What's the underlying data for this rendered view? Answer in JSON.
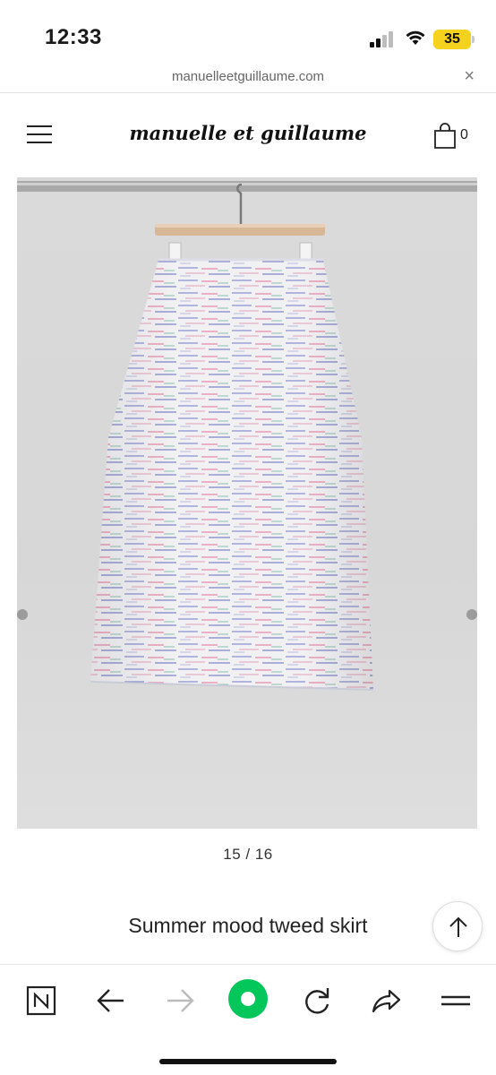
{
  "status": {
    "time": "12:33",
    "battery": "35"
  },
  "browser": {
    "url": "manuelleetguillaume.com",
    "close_label": "×"
  },
  "site": {
    "brand": "manuelle et guillaume",
    "cart_count": "0"
  },
  "product": {
    "image_alt": "Summer mood tweed skirt on hanger",
    "counter": "15 / 16",
    "title": "Summer mood tweed skirt"
  },
  "toolbar": {
    "items": [
      {
        "name": "naver-home",
        "icon": "naver-n-icon"
      },
      {
        "name": "back",
        "icon": "arrow-left-icon"
      },
      {
        "name": "forward",
        "icon": "arrow-right-icon",
        "disabled": true
      },
      {
        "name": "green-dot",
        "icon": "green-dot-icon"
      },
      {
        "name": "reload",
        "icon": "reload-icon"
      },
      {
        "name": "share",
        "icon": "share-icon"
      },
      {
        "name": "menu",
        "icon": "menu-icon"
      }
    ]
  },
  "colors": {
    "accent_green": "#03c75a",
    "battery": "#f5d21e"
  }
}
